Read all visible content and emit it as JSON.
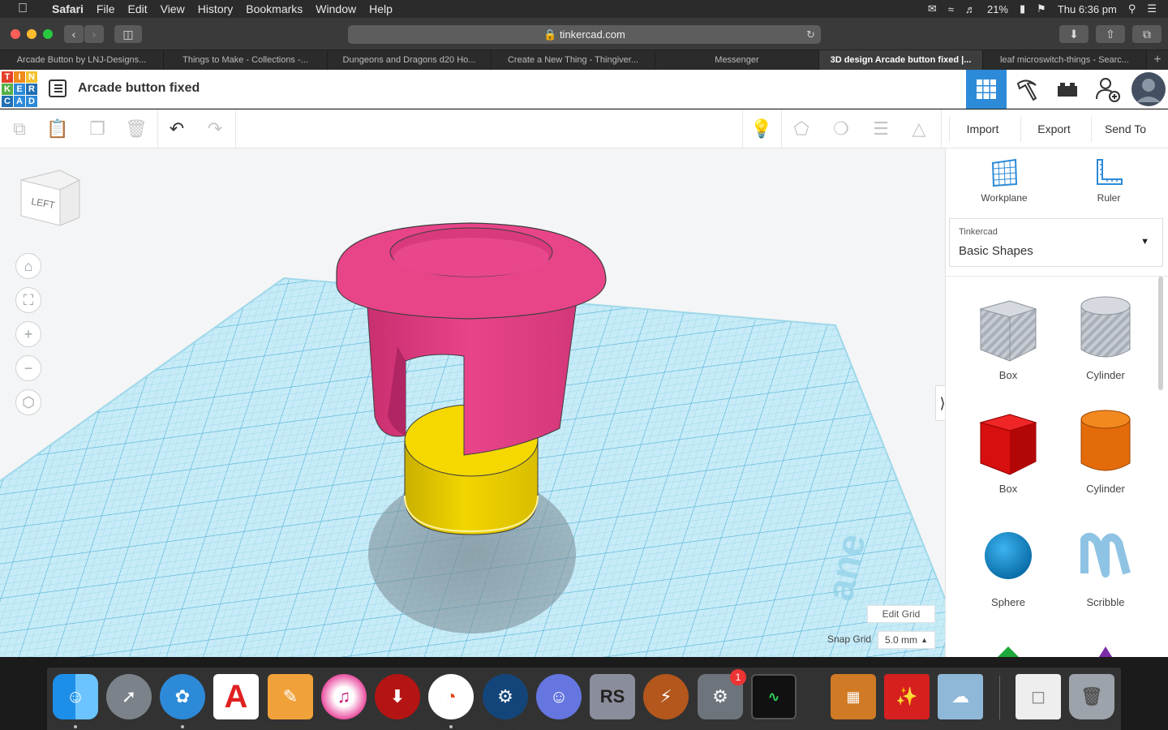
{
  "menubar": {
    "app": "Safari",
    "items": [
      "File",
      "Edit",
      "View",
      "History",
      "Bookmarks",
      "Window",
      "Help"
    ],
    "battery": "21%",
    "clock": "Thu 6:36 pm"
  },
  "browser": {
    "url": "tinkercad.com",
    "tabs": [
      {
        "label": "Arcade Button by LNJ-Designs...",
        "active": false
      },
      {
        "label": "Things to Make - Collections -...",
        "active": false
      },
      {
        "label": "Dungeons and Dragons d20 Ho...",
        "active": false
      },
      {
        "label": "Create a New Thing - Thingiver...",
        "active": false
      },
      {
        "label": "Messenger",
        "active": false
      },
      {
        "label": "3D design Arcade button fixed |...",
        "active": true
      },
      {
        "label": "leaf microswitch-things - Searc...",
        "active": false
      }
    ]
  },
  "tinkercad": {
    "logo_letters": [
      "T",
      "I",
      "N",
      "K",
      "E",
      "R",
      "C",
      "A",
      "D"
    ],
    "design_title": "Arcade button fixed",
    "header_buttons": [
      "3d-view-grid",
      "codeblocks-pickaxe",
      "bricks",
      "add-user"
    ],
    "toolbar": {
      "import_label": "Import",
      "export_label": "Export",
      "send_to_label": "Send To"
    },
    "viewcube_face": "LEFT",
    "edit_grid_label": "Edit Grid",
    "snap_grid_label": "Snap Grid",
    "snap_grid_value": "5.0 mm"
  },
  "right_panel": {
    "workplane_label": "Workplane",
    "ruler_label": "Ruler",
    "library_small": "Tinkercad",
    "library_name": "Basic Shapes",
    "shapes": [
      {
        "label": "Box",
        "icon": "box-hole-icon"
      },
      {
        "label": "Cylinder",
        "icon": "cylinder-hole-icon"
      },
      {
        "label": "Box",
        "icon": "box-solid-icon"
      },
      {
        "label": "Cylinder",
        "icon": "cylinder-solid-icon"
      },
      {
        "label": "Sphere",
        "icon": "sphere-icon"
      },
      {
        "label": "Scribble",
        "icon": "scribble-icon"
      }
    ]
  },
  "dock": {
    "apps": [
      "Finder",
      "Launchpad",
      "Safari",
      "AutoCAD",
      "Pages",
      "iTunes",
      "Downloader",
      "Clock app",
      "Steam",
      "Discord",
      "RS",
      "Spark",
      "System Preferences",
      "Activity Monitor",
      "Calculator",
      "Acrobat",
      "Preview",
      "Files",
      "Trash"
    ],
    "sysprefs_badge": "1"
  },
  "colors": {
    "accent": "#2d8ad8",
    "pink_part": "#e63f86",
    "yellow_part": "#f2d400",
    "grid": "#bfe5f2"
  }
}
